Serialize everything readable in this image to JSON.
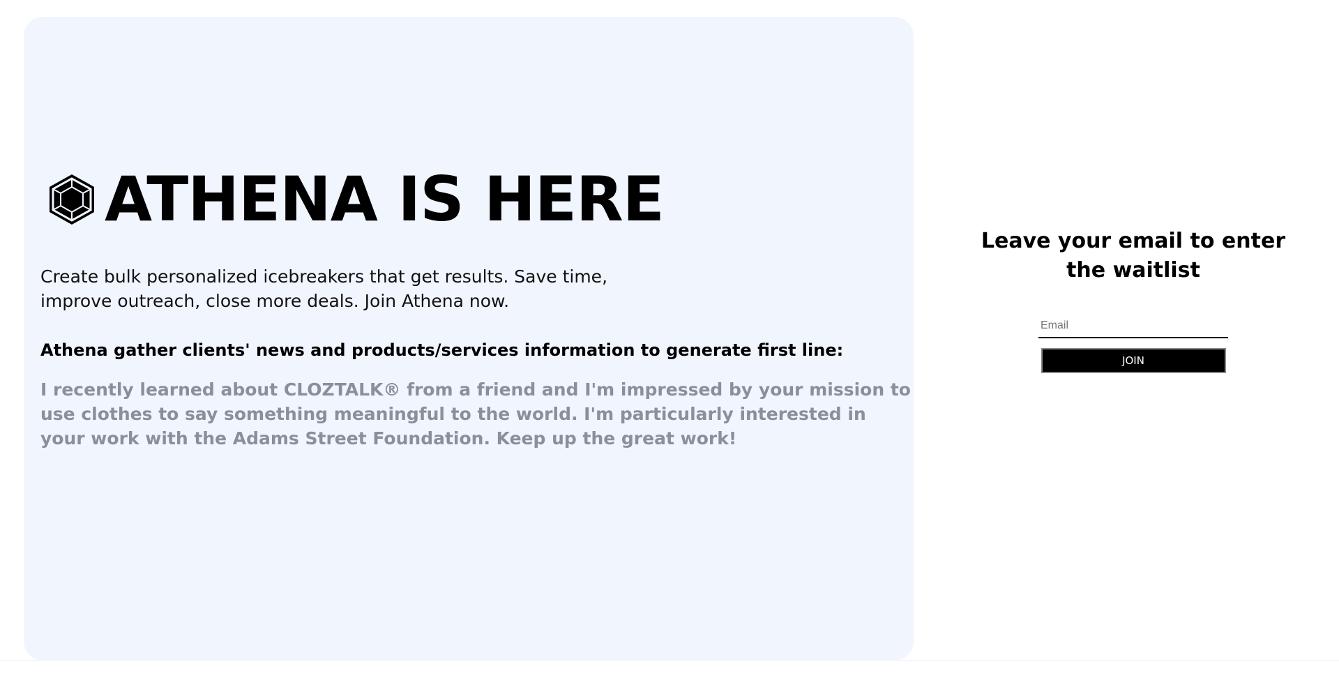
{
  "hero": {
    "logo_icon": "hexagon-gem-icon",
    "title": "ATHENA IS HERE",
    "subtitle": "Create bulk personalized icebreakers that get results. Save time, improve outreach, close more deals. Join Athena now.",
    "features_heading": "Athena gather clients' news and products/services information to generate first line:",
    "example_line": "I recently learned about CLOZTALK® from a friend and I'm impressed by your mission to use clothes to say something meaningful to the world. I'm particularly interested in your work with the Adams Street Foundation. Keep up the great work!"
  },
  "waitlist": {
    "title": "Leave your email to enter the waitlist",
    "email_placeholder": "Email",
    "email_value": "",
    "join_label": "JOIN"
  },
  "colors": {
    "panel_background": "#f1f5fe",
    "example_text": "#8a8f99",
    "button_background": "#000000"
  }
}
